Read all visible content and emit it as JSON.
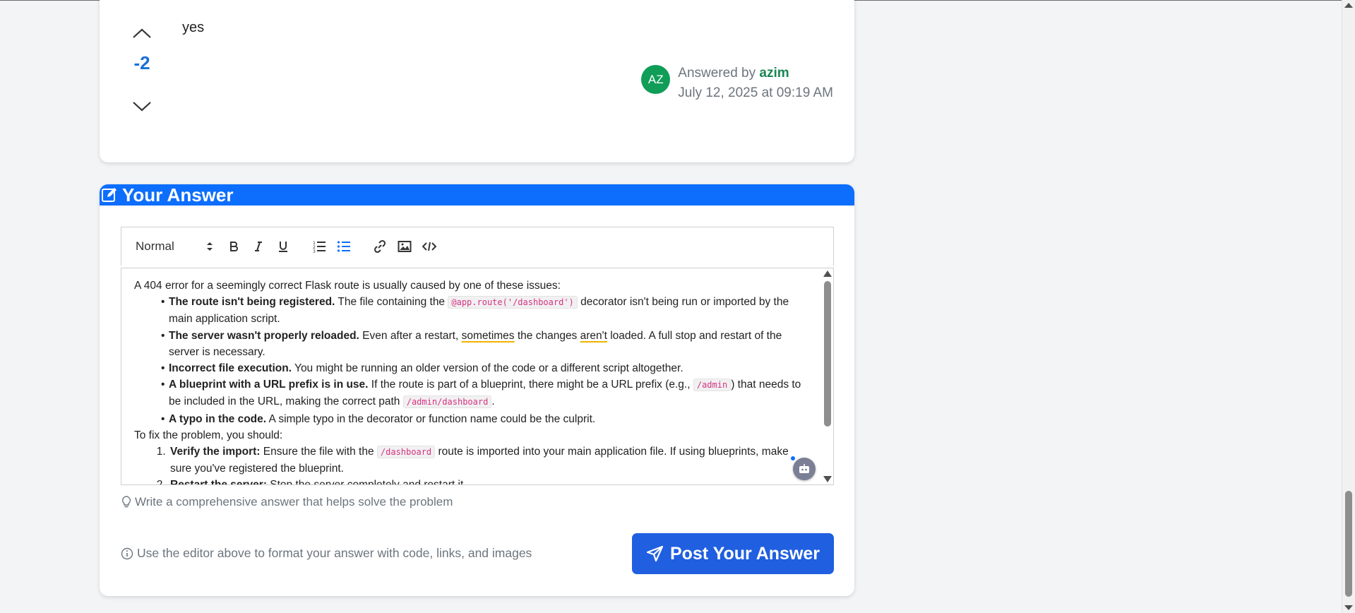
{
  "answer": {
    "body": "yes",
    "vote_count": "-2",
    "author": {
      "initials": "AZ",
      "answered_by_label": "Answered by",
      "name": "azim",
      "date": "July 12, 2025 at 09:19 AM",
      "avatar_color": "#0f9d58"
    }
  },
  "your_answer": {
    "title": "Your Answer",
    "header_color": "#0d6efd",
    "toolbar": {
      "format_select": "Normal",
      "buttons": [
        "bold-icon",
        "italic-icon",
        "underline-icon",
        "ordered-list-icon",
        "bullet-list-icon",
        "link-icon",
        "image-icon",
        "code-icon"
      ]
    },
    "editor": {
      "intro": "A 404 error for a seemingly correct Flask route is usually caused by one of these issues:",
      "bullets": [
        {
          "bold": "The route isn't being registered.",
          "pre": " The file containing the ",
          "code": "@app.route('/dashboard')",
          "post": " decorator isn't being run or imported by the main application script."
        },
        {
          "bold": "The server wasn't properly reloaded.",
          "pre": " Even after a restart, ",
          "w1": "sometimes",
          "mid": " the changes ",
          "w2": "aren't",
          "post": " loaded. A full stop and restart of the server is necessary."
        },
        {
          "bold": "Incorrect file execution.",
          "text": " You might be running an older version of the code or a different script altogether."
        },
        {
          "bold": "A blueprint with a URL prefix is in use.",
          "pre": " If the route is part of a blueprint, there might be a URL prefix (e.g., ",
          "code1": "/admin",
          "mid": ") that needs to be included in the URL, making the correct path ",
          "code2": "/admin/dashboard",
          "post": "."
        },
        {
          "bold": "A typo in the code.",
          "text": " A simple typo in the decorator or function name could be the culprit."
        }
      ],
      "fix_intro": "To fix the problem, you should:",
      "steps": [
        {
          "bold": "Verify the import:",
          "pre": " Ensure the file with the ",
          "code": "/dashboard",
          "post": " route is imported into your main application file. If using blueprints, make sure you've registered the blueprint."
        },
        {
          "bold": "Restart the server:",
          "text": " Stop the server completely and restart it."
        }
      ]
    },
    "hint": "Write a comprehensive answer that helps solve the problem",
    "info": "Use the editor above to format your answer with code, links, and images",
    "post_button": "Post Your Answer",
    "post_button_color": "#1f5fe0"
  }
}
